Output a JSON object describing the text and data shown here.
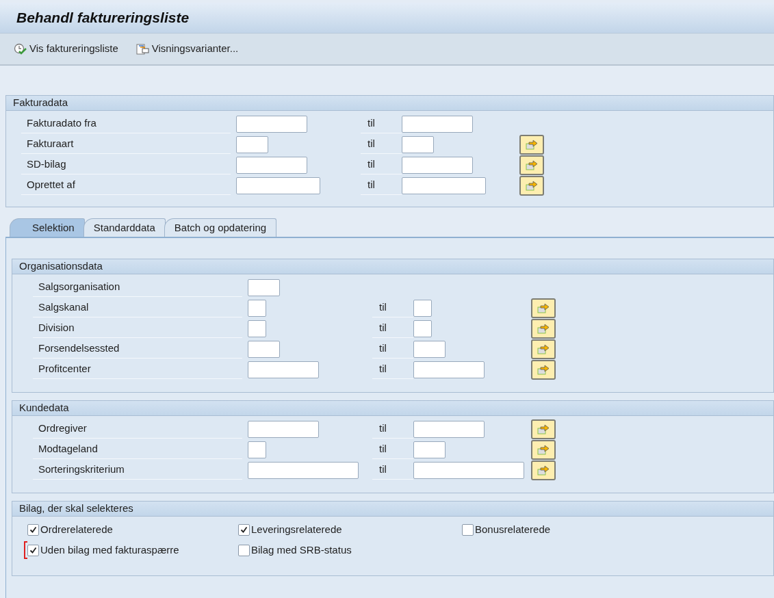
{
  "window": {
    "title": "Behandl faktureringsliste"
  },
  "toolbar": [
    {
      "kind": "execute",
      "label": "Vis faktureringsliste"
    },
    {
      "kind": "variants",
      "label": "Visningsvarianter..."
    }
  ],
  "header_group": {
    "title": "Fakturadata",
    "rows": [
      {
        "label": "Fakturadato fra",
        "to_label": "til",
        "multi": false
      },
      {
        "label": "Fakturaart",
        "to_label": "til",
        "multi": true
      },
      {
        "label": "SD-bilag",
        "to_label": "til",
        "multi": true
      },
      {
        "label": "Oprettet af",
        "to_label": "til",
        "multi": true
      }
    ]
  },
  "tabs": [
    {
      "label": "Selektion",
      "selected": true
    },
    {
      "label": "Standarddata",
      "selected": false
    },
    {
      "label": "Batch og opdatering",
      "selected": false
    }
  ],
  "groups": [
    {
      "title": "Organisationsdata",
      "rows": [
        {
          "label": "Salgsorganisation",
          "multi": false
        },
        {
          "label": "Salgskanal",
          "to_label": "til",
          "multi": true
        },
        {
          "label": "Division",
          "to_label": "til",
          "multi": true
        },
        {
          "label": "Forsendelsessted",
          "to_label": "til",
          "multi": true
        },
        {
          "label": "Profitcenter",
          "to_label": "til",
          "multi": true
        }
      ]
    },
    {
      "title": "Kundedata",
      "rows": [
        {
          "label": "Ordregiver",
          "to_label": "til",
          "multi": true
        },
        {
          "label": "Modtageland",
          "to_label": "til",
          "multi": true
        },
        {
          "label": "Sorteringskriterium",
          "to_label": "til",
          "multi": true
        }
      ]
    }
  ],
  "checkbox_group": {
    "title": "Bilag, der skal selekteres",
    "rows": [
      [
        {
          "label": "Ordrerelaterede",
          "checked": true,
          "focused": false
        },
        {
          "label": "Leveringsrelaterede",
          "checked": true,
          "focused": false
        },
        {
          "label": "Bonusrelaterede",
          "checked": false,
          "focused": false
        }
      ],
      [
        {
          "label": "Uden bilag med fakturaspærre",
          "checked": true,
          "focused": true
        },
        {
          "label": "Bilag med SRB-status",
          "checked": false,
          "focused": false
        }
      ]
    ]
  }
}
